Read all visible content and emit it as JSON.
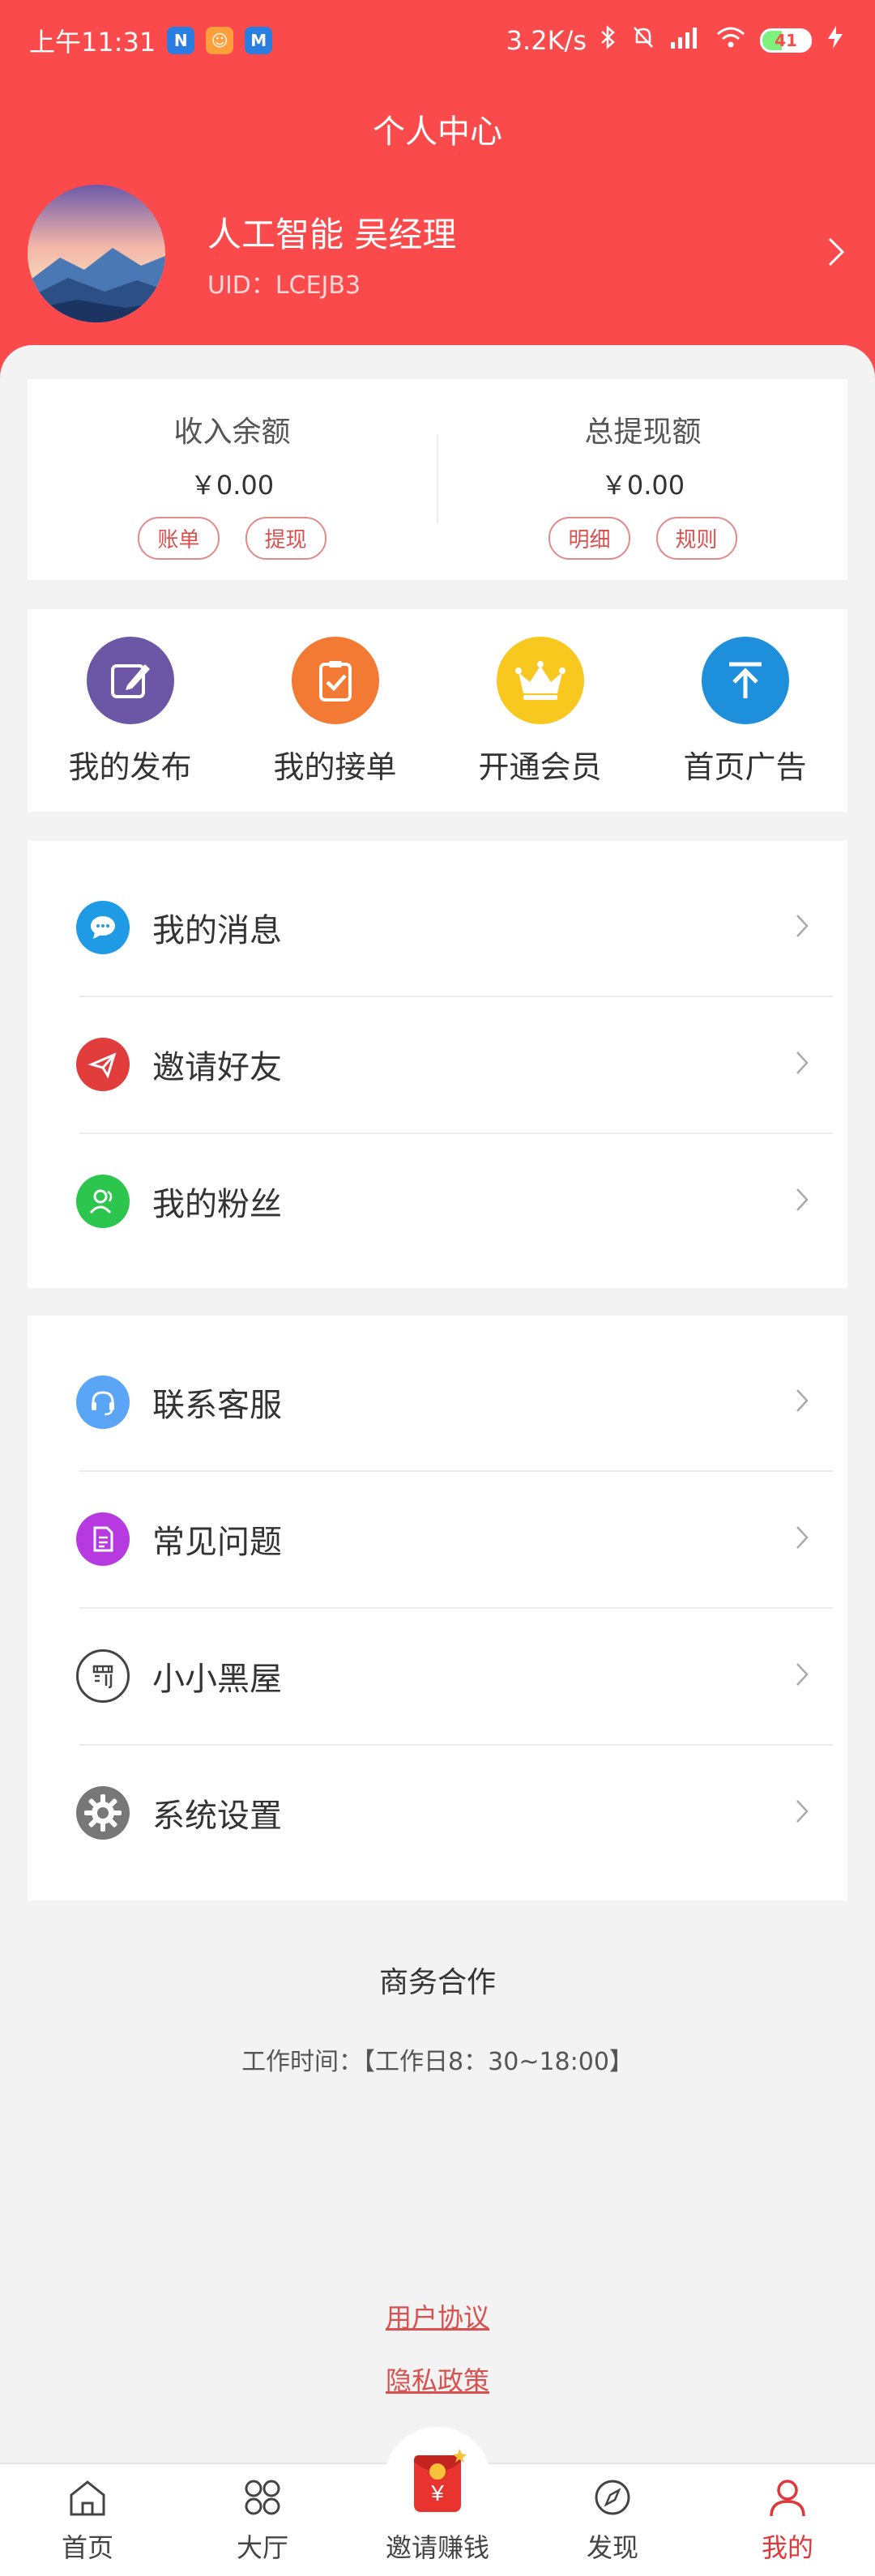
{
  "status_bar": {
    "time": "上午11:31",
    "network_speed": "3.2K/s",
    "battery": "41",
    "app_icons": [
      "N",
      "☺",
      "M"
    ]
  },
  "header": {
    "title": "个人中心",
    "user_name": "人工智能 吴经理",
    "uid": "UID：LCEJB3"
  },
  "balance": {
    "income": {
      "label": "收入余额",
      "amount": "￥0.00",
      "btn1": "账单",
      "btn2": "提现"
    },
    "withdraw": {
      "label": "总提现额",
      "amount": "￥0.00",
      "btn1": "明细",
      "btn2": "规则"
    }
  },
  "grid": {
    "items": [
      {
        "label": "我的发布",
        "icon": "edit-icon",
        "color": "#6c56a6"
      },
      {
        "label": "我的接单",
        "icon": "clipboard-check-icon",
        "color": "#f27a35"
      },
      {
        "label": "开通会员",
        "icon": "crown-icon",
        "color": "#f8c81f"
      },
      {
        "label": "首页广告",
        "icon": "arrow-up-icon",
        "color": "#1e8fda"
      }
    ]
  },
  "menu1": {
    "items": [
      {
        "label": "我的消息",
        "icon": "chat-icon",
        "color": "#1f9be6"
      },
      {
        "label": "邀请好友",
        "icon": "paper-plane-icon",
        "color": "#e23d3d"
      },
      {
        "label": "我的粉丝",
        "icon": "users-icon",
        "color": "#2cc64f"
      }
    ]
  },
  "menu2": {
    "items": [
      {
        "label": "联系客服",
        "icon": "headset-icon",
        "color": "#5aa5f5"
      },
      {
        "label": "常见问题",
        "icon": "document-icon",
        "color": "#b63ae0"
      },
      {
        "label": "小小黑屋",
        "icon": "penalty-icon",
        "color": "#444444"
      },
      {
        "label": "系统设置",
        "icon": "gear-icon",
        "color": "#777777"
      }
    ]
  },
  "business": {
    "title": "商务合作",
    "hours": "工作时间：【工作日8：30~18:00】"
  },
  "links": {
    "agreement": "用户协议",
    "privacy": "隐私政策"
  },
  "bottom_nav": {
    "items": [
      {
        "label": "首页",
        "icon": "home-icon"
      },
      {
        "label": "大厅",
        "icon": "hall-icon"
      },
      {
        "label": "邀请赚钱",
        "icon": "red-envelope-icon"
      },
      {
        "label": "发现",
        "icon": "compass-icon"
      },
      {
        "label": "我的",
        "icon": "user-icon"
      }
    ],
    "active_index": 4
  },
  "colors": {
    "brand": "#fb4a4c",
    "accent_text": "#d9504f",
    "background": "#f3f3f3"
  }
}
